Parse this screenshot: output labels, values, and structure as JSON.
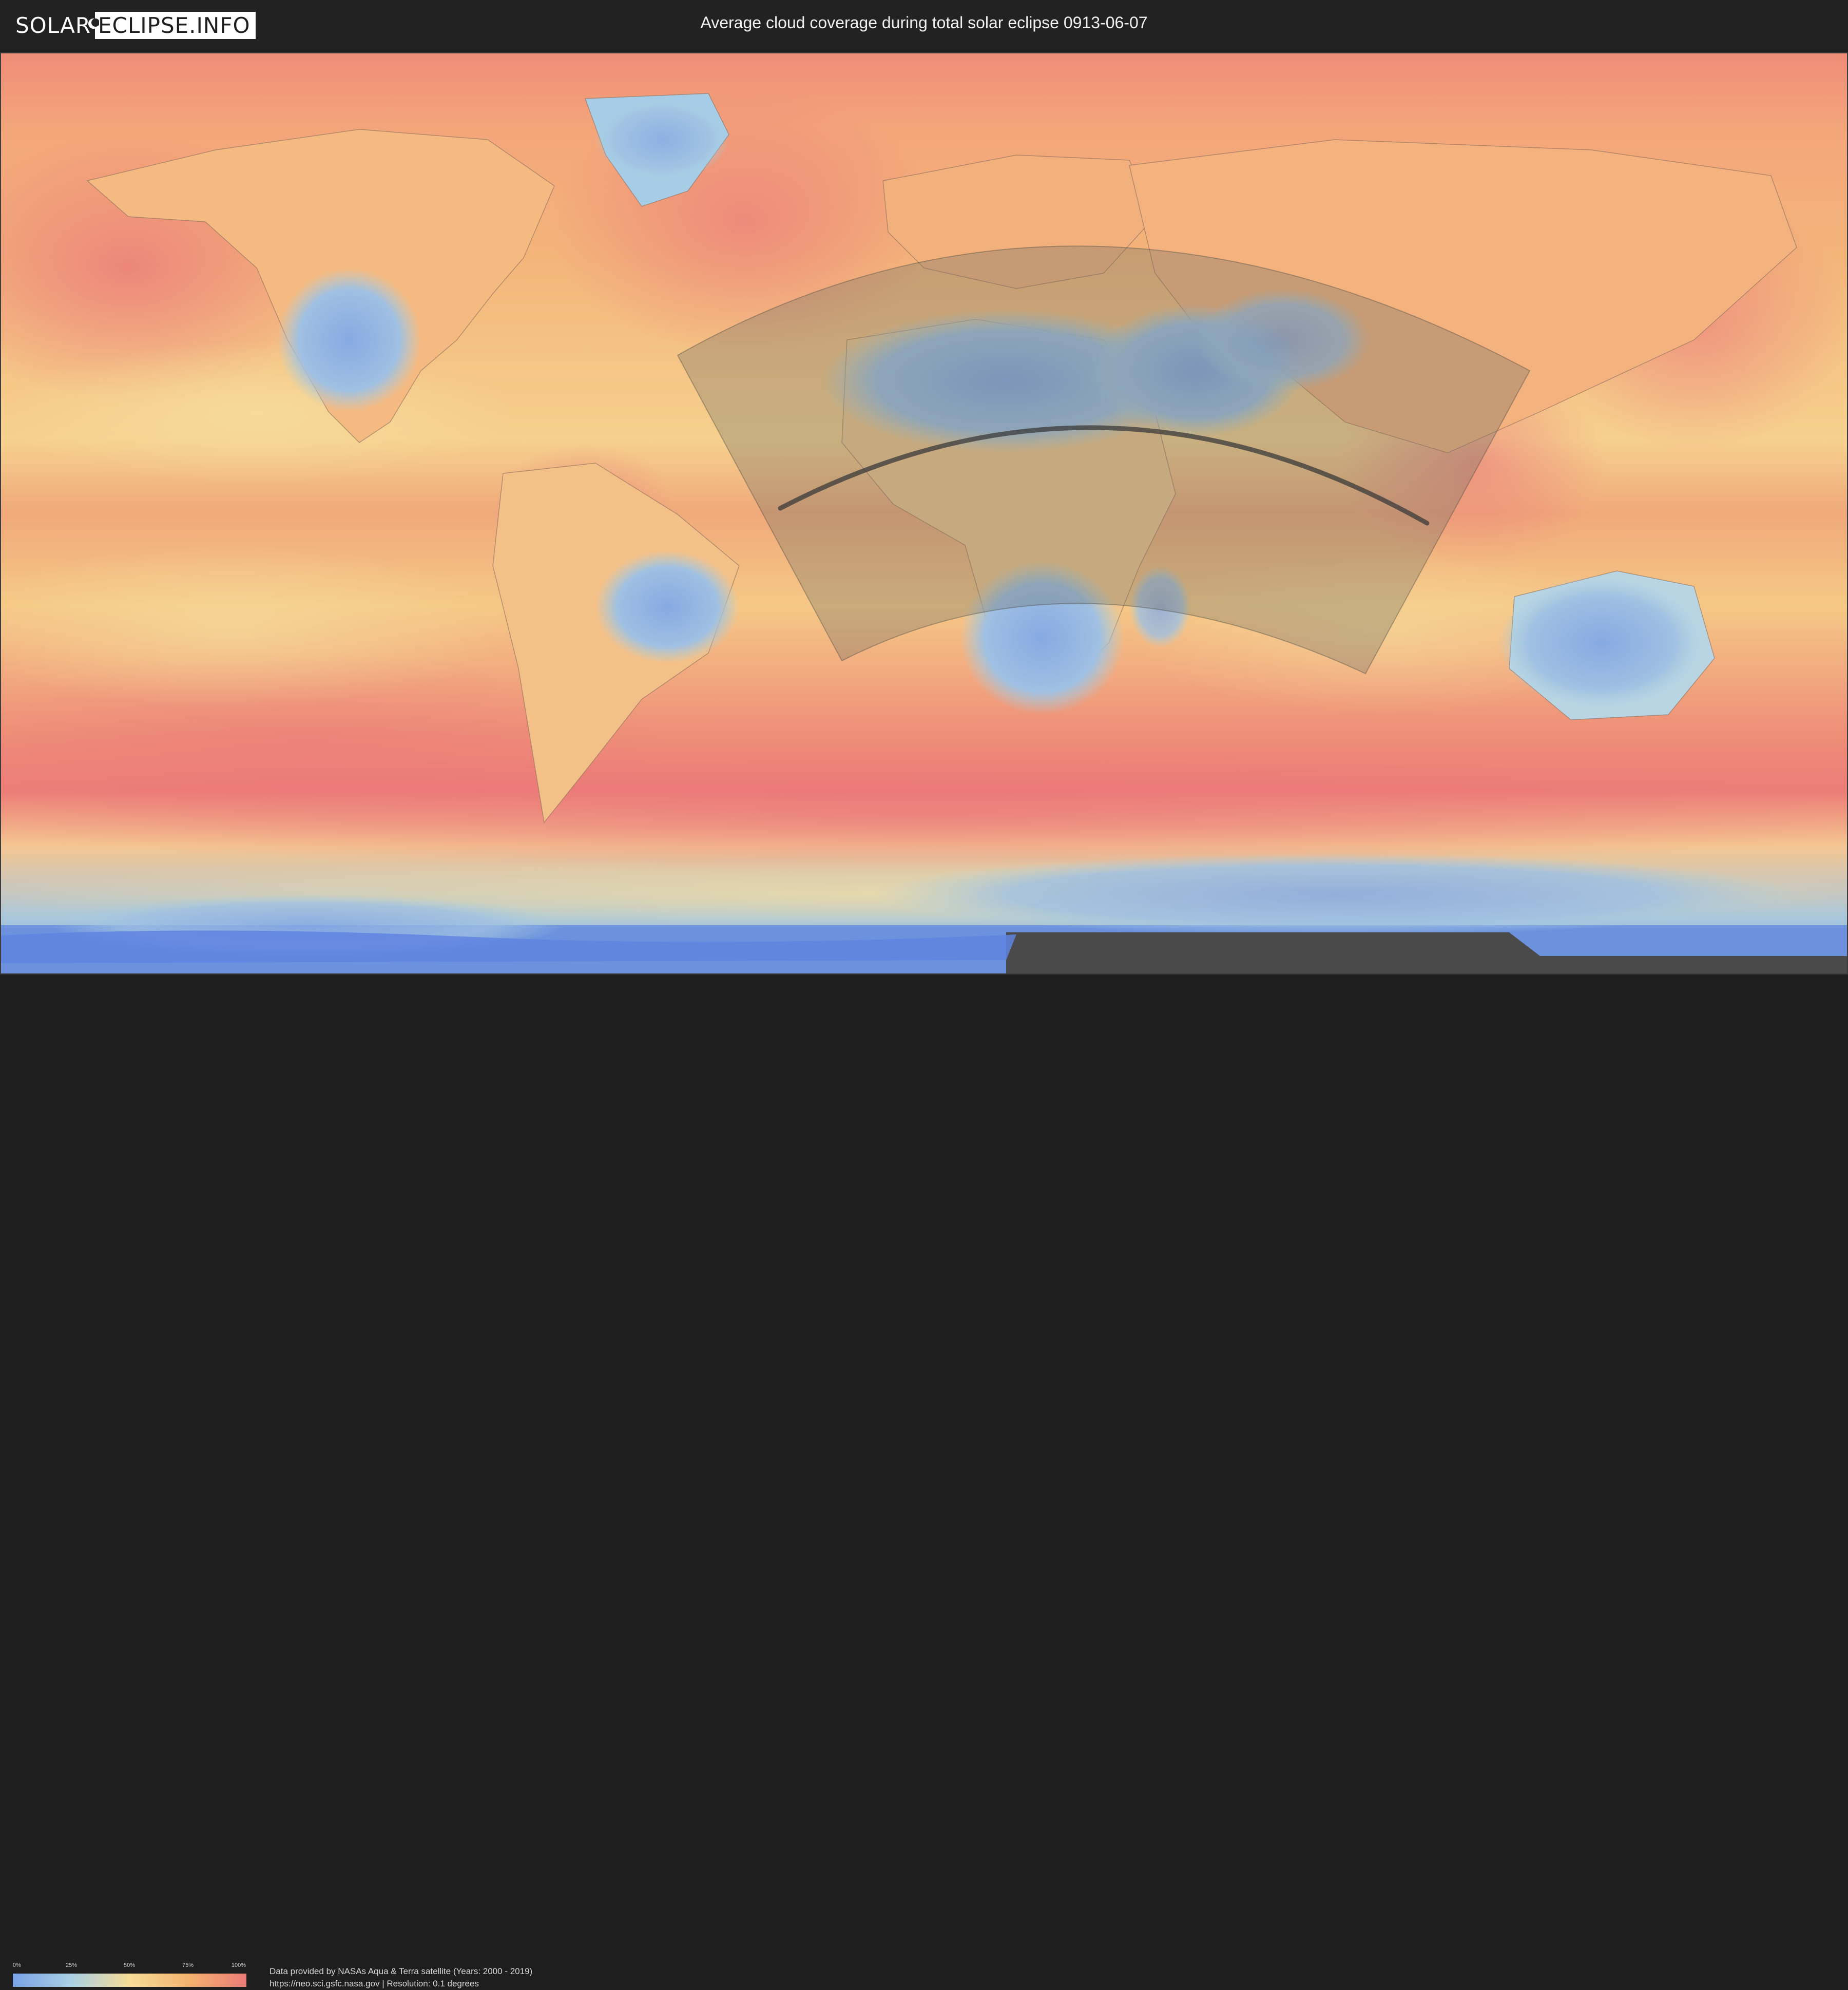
{
  "header": {
    "logo_left": "SOLAR",
    "logo_right": "ECLIPSE.INFO",
    "title": "Average cloud coverage during total solar eclipse 0913-06-07"
  },
  "legend": {
    "ticks": [
      "0%",
      "25%",
      "50%",
      "75%",
      "100%"
    ],
    "colors": [
      "#7aa3e6",
      "#a9d0e4",
      "#f6dc97",
      "#f3b46f",
      "#ec7c78"
    ]
  },
  "footer": {
    "credit_line1": "Data provided by NASAs Aqua & Terra satellite (Years: 2000 - 2019)",
    "credit_line2": "https://neo.sci.gsfc.nasa.gov | Resolution: 0.1 degrees"
  },
  "map": {
    "projection": "equirectangular world",
    "overlays": [
      "eclipse-visibility-zone",
      "totality-path"
    ]
  }
}
